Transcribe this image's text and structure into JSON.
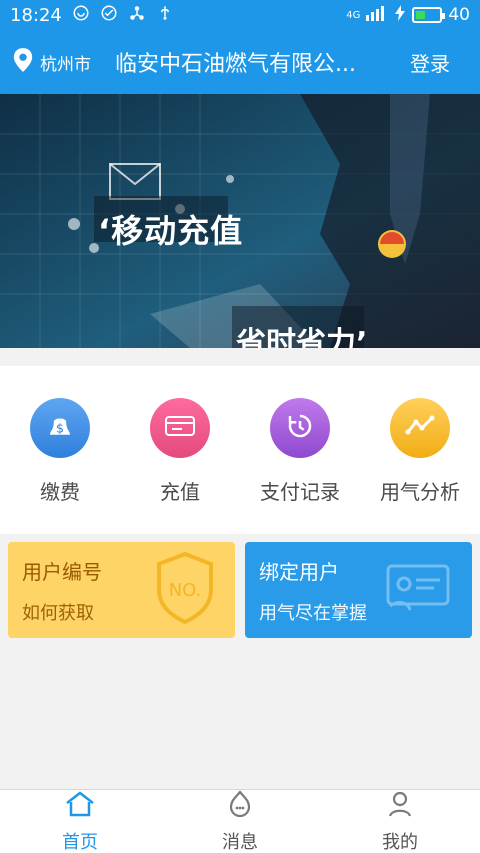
{
  "status": {
    "time": "18:24",
    "signal_label": "4G",
    "battery_level": "40",
    "battery_fill_pct": 40
  },
  "header": {
    "city": "杭州市",
    "company": "临安中石油燃气有限公...",
    "login": "登录"
  },
  "banner": {
    "line1": "‘移动充值",
    "line2": "省时省力’",
    "dots_active_index": 1
  },
  "actions": [
    {
      "label": "缴费",
      "color": "#4a8ee6"
    },
    {
      "label": "充值",
      "color": "#e94b7c"
    },
    {
      "label": "支付记录",
      "color": "#a35bd6"
    },
    {
      "label": "用气分析",
      "color": "#f1b21e"
    }
  ],
  "cards": {
    "left": {
      "title": "用户编号",
      "subtitle": "如何获取"
    },
    "right": {
      "title": "绑定用户",
      "subtitle": "用气尽在掌握"
    }
  },
  "nav": [
    {
      "label": "首页"
    },
    {
      "label": "消息"
    },
    {
      "label": "我的"
    }
  ]
}
